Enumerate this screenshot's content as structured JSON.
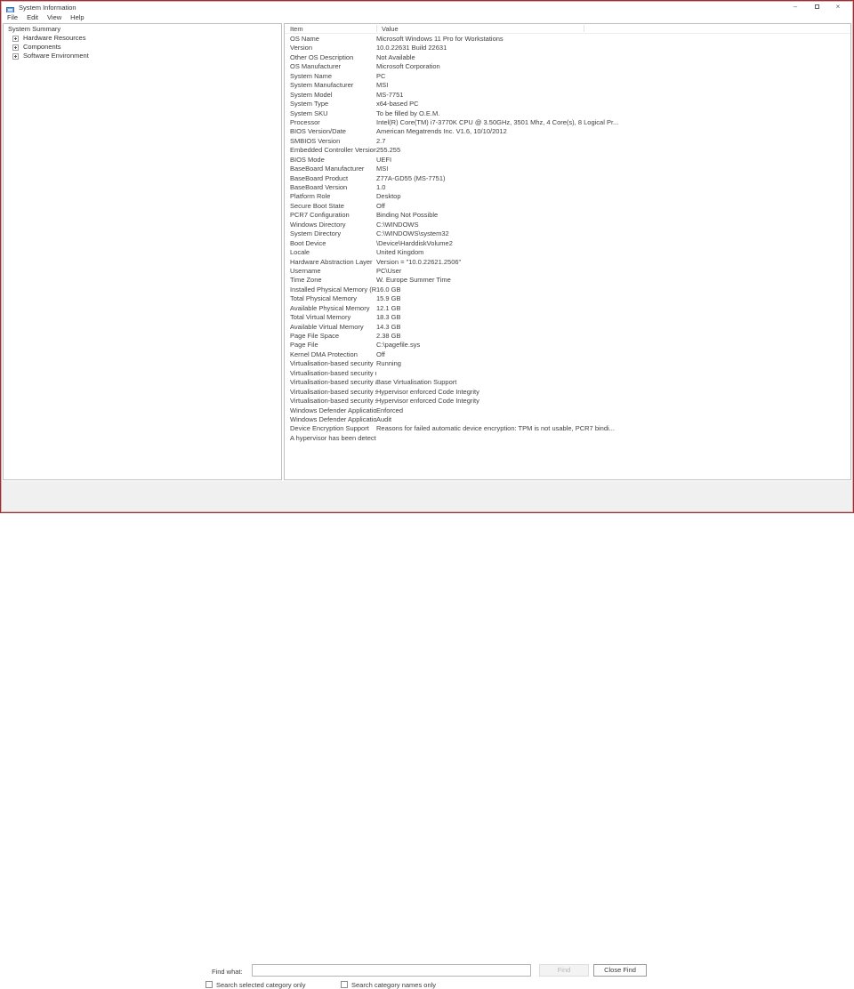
{
  "window": {
    "title": "System Information",
    "icons": {
      "minimize_glyph": "–",
      "close_glyph": "×"
    }
  },
  "menu": {
    "items": [
      "File",
      "Edit",
      "View",
      "Help"
    ]
  },
  "tree": {
    "root": "System Summary",
    "items": [
      {
        "label": "Hardware Resources"
      },
      {
        "label": "Components"
      },
      {
        "label": "Software Environment"
      }
    ]
  },
  "table": {
    "columns": [
      "Item",
      "Value"
    ],
    "rows": [
      [
        "OS Name",
        "Microsoft Windows 11 Pro for Workstations"
      ],
      [
        "Version",
        "10.0.22631 Build 22631"
      ],
      [
        "Other OS Description",
        "Not Available"
      ],
      [
        "OS Manufacturer",
        "Microsoft Corporation"
      ],
      [
        "System Name",
        "PC"
      ],
      [
        "System Manufacturer",
        "MSI"
      ],
      [
        "System Model",
        "MS-7751"
      ],
      [
        "System Type",
        "x64-based PC"
      ],
      [
        "System SKU",
        "To be filled by O.E.M."
      ],
      [
        "Processor",
        "Intel(R) Core(TM) i7-3770K CPU @ 3.50GHz, 3501 Mhz, 4 Core(s), 8 Logical Pr..."
      ],
      [
        "BIOS Version/Date",
        "American Megatrends Inc. V1.6, 10/10/2012"
      ],
      [
        "SMBIOS Version",
        "2.7"
      ],
      [
        "Embedded Controller Version",
        "255.255"
      ],
      [
        "BIOS Mode",
        "UEFI"
      ],
      [
        "BaseBoard Manufacturer",
        "MSI"
      ],
      [
        "BaseBoard Product",
        "Z77A-GD55 (MS-7751)"
      ],
      [
        "BaseBoard Version",
        "1.0"
      ],
      [
        "Platform Role",
        "Desktop"
      ],
      [
        "Secure Boot State",
        "Off"
      ],
      [
        "PCR7 Configuration",
        "Binding Not Possible"
      ],
      [
        "Windows Directory",
        "C:\\WINDOWS"
      ],
      [
        "System Directory",
        "C:\\WINDOWS\\system32"
      ],
      [
        "Boot Device",
        "\\Device\\HarddiskVolume2"
      ],
      [
        "Locale",
        "United Kingdom"
      ],
      [
        "Hardware Abstraction Layer",
        "Version = \"10.0.22621.2506\""
      ],
      [
        "Username",
        "PC\\User"
      ],
      [
        "Time Zone",
        "W. Europe Summer Time"
      ],
      [
        "Installed Physical Memory (RAM)",
        "16.0 GB"
      ],
      [
        "Total Physical Memory",
        "15.9 GB"
      ],
      [
        "Available Physical Memory",
        "12.1 GB"
      ],
      [
        "Total Virtual Memory",
        "18.3 GB"
      ],
      [
        "Available Virtual Memory",
        "14.3 GB"
      ],
      [
        "Page File Space",
        "2.38 GB"
      ],
      [
        "Page File",
        "C:\\pagefile.sys"
      ],
      [
        "Kernel DMA Protection",
        "Off"
      ],
      [
        "Virtualisation-based security",
        "Running"
      ],
      [
        "Virtualisation-based security re...",
        ""
      ],
      [
        "Virtualisation-based security av...",
        "Base Virtualisation Support"
      ],
      [
        "Virtualisation-based security se...",
        "Hypervisor enforced Code Integrity"
      ],
      [
        "Virtualisation-based security se...",
        "Hypervisor enforced Code Integrity"
      ],
      [
        "Windows Defender Application...",
        "Enforced"
      ],
      [
        "Windows Defender Application...",
        "Audit"
      ],
      [
        "Device Encryption Support",
        "Reasons for failed automatic device encryption: TPM is not usable, PCR7 bindi..."
      ],
      [
        "A hypervisor has been detecte...",
        ""
      ]
    ]
  },
  "find": {
    "label": "Find what:",
    "value": "",
    "find_button": "Find",
    "close_button": "Close Find",
    "checkbox_selected_category": "Search selected category only",
    "checkbox_category_names": "Search category names only"
  }
}
